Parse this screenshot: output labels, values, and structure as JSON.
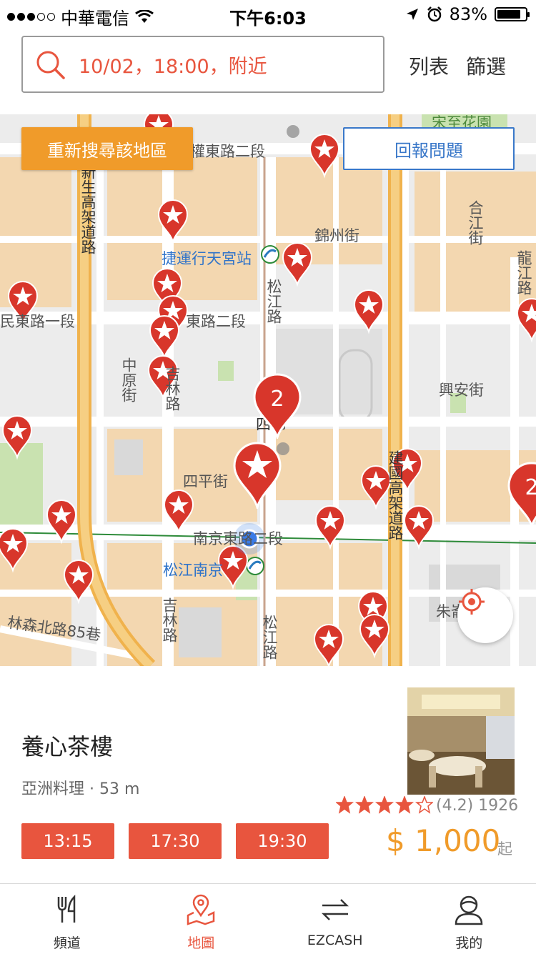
{
  "status_bar": {
    "carrier": "中華電信",
    "time": "下午6:03",
    "battery": "83%",
    "battery_level": 0.83
  },
  "search": {
    "query": "10/02，18:00，附近"
  },
  "header": {
    "list_label": "列表",
    "filter_label": "篩選"
  },
  "map": {
    "research_label": "重新搜尋該地區",
    "report_label": "回報問題",
    "cluster_counts": [
      "2",
      "2"
    ],
    "labels": {
      "road1": "權東路二段",
      "road2": "錦州街",
      "station1": "捷運行天宮站",
      "road3": "東路二段",
      "road4": "民東路一段",
      "road5": "松江路",
      "road6": "中原街",
      "road7": "吉林路",
      "road8": "興安街",
      "road9": "四平街",
      "road10": "南京東路二段",
      "station2": "松江南京",
      "road11": "林森北路85巷",
      "road12": "新生高架道路",
      "road13": "建國高架道路",
      "road14": "合江街",
      "road15": "龍江路",
      "poi1": "宋至花園",
      "poi2": "四佛",
      "road16": "朱崙街",
      "road17": "松江路",
      "road18": "吉林路"
    }
  },
  "restaurant": {
    "name": "養心茶樓",
    "category": "亞洲料理",
    "distance": "53 m",
    "rating_text": "(4.2) 1926",
    "rating": 4.2,
    "time_slots": [
      "13:15",
      "17:30",
      "19:30"
    ],
    "price": "$ 1,000",
    "price_suffix": "起"
  },
  "tabs": [
    {
      "label": "頻道"
    },
    {
      "label": "地圖"
    },
    {
      "label": "EZCASH"
    },
    {
      "label": "我的"
    }
  ],
  "colors": {
    "accent_red": "#e8553e",
    "pin_red": "#d8362b",
    "orange": "#f09b2a",
    "blue": "#3a78c9"
  }
}
